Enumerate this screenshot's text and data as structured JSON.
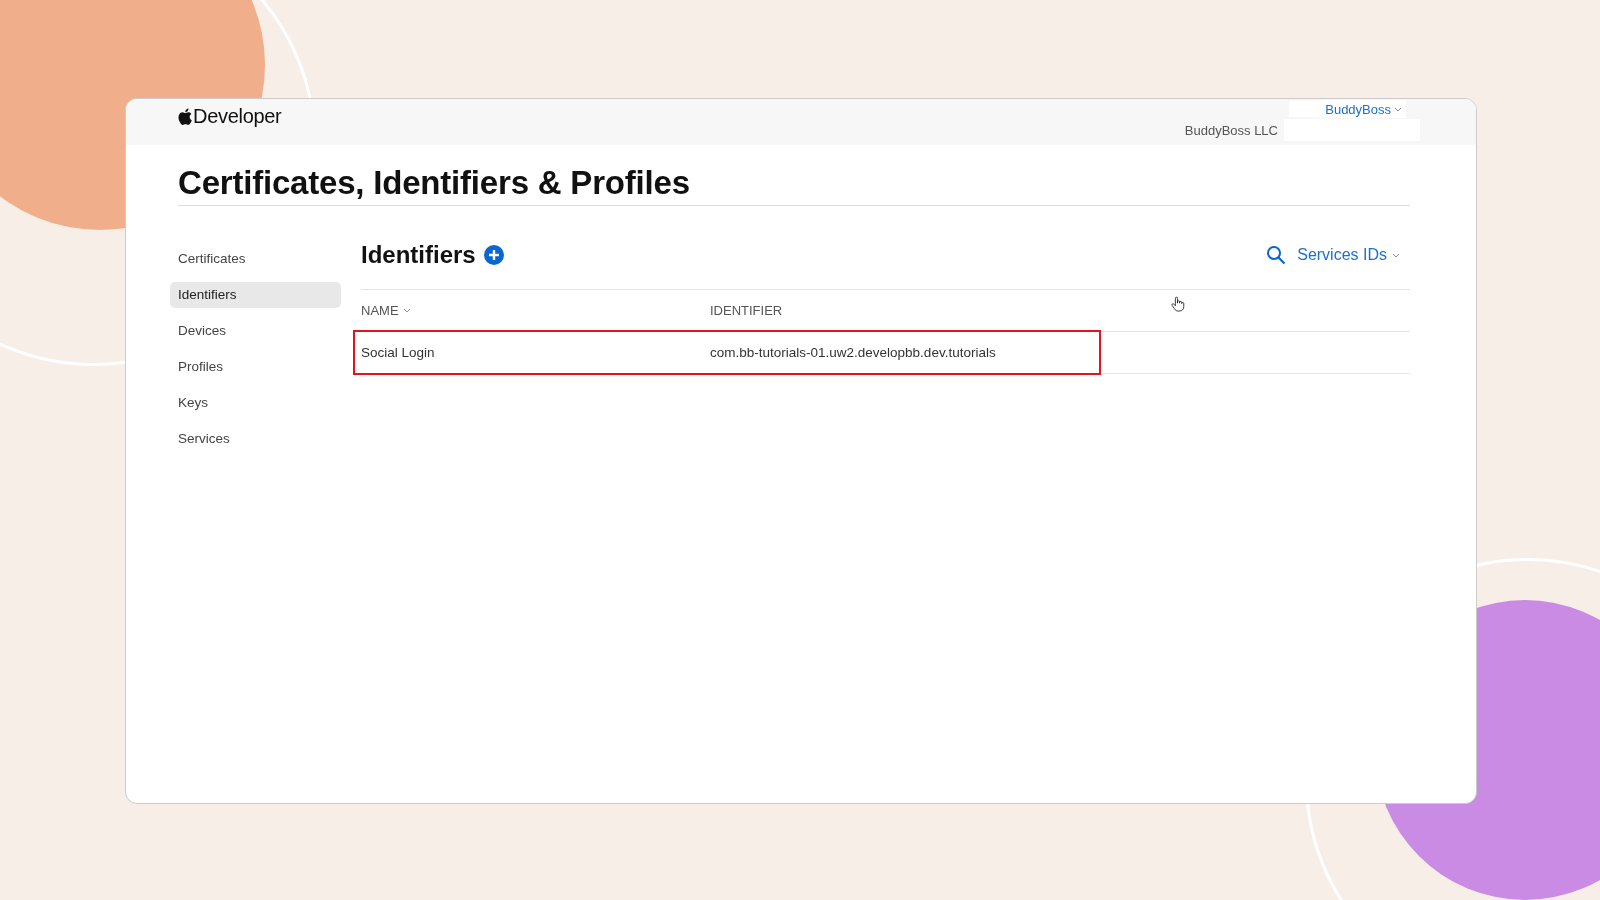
{
  "header": {
    "logo_text": "Developer",
    "account_menu": "BuddyBoss",
    "team_name": "BuddyBoss LLC"
  },
  "page_title": "Certificates, Identifiers & Profiles",
  "sidebar": {
    "items": [
      {
        "label": "Certificates",
        "selected": false
      },
      {
        "label": "Identifiers",
        "selected": true
      },
      {
        "label": "Devices",
        "selected": false
      },
      {
        "label": "Profiles",
        "selected": false
      },
      {
        "label": "Keys",
        "selected": false
      },
      {
        "label": "Services",
        "selected": false
      }
    ]
  },
  "section": {
    "title": "Identifiers",
    "filter": "Services IDs"
  },
  "table": {
    "columns": [
      {
        "label": "NAME",
        "sortable": true
      },
      {
        "label": "IDENTIFIER",
        "sortable": false
      }
    ],
    "rows": [
      {
        "cells": [
          "Social Login",
          "com.bb-tutorials-01.uw2.developbb.dev.tutorials"
        ],
        "highlighted": true
      }
    ]
  }
}
